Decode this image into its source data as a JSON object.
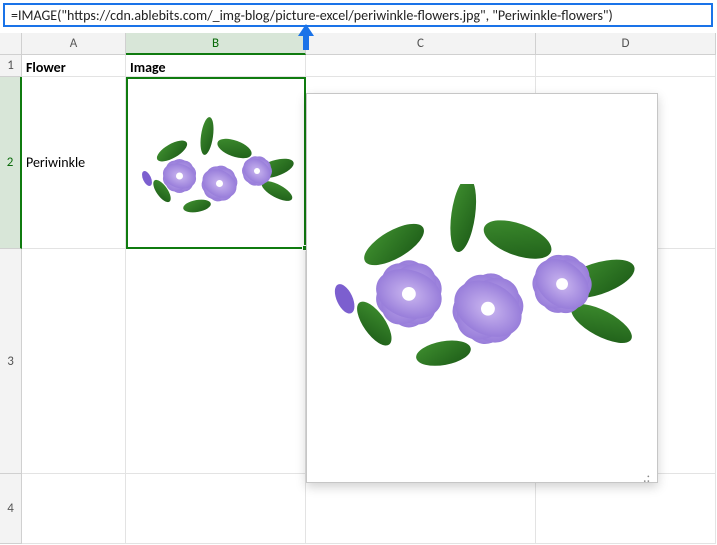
{
  "formula_bar": {
    "text": "=IMAGE(\"https://cdn.ablebits.com/_img-blog/picture-excel/periwinkle-flowers.jpg\", \"Periwinkle-flowers\")"
  },
  "columns": {
    "A": "A",
    "B": "B",
    "C": "C",
    "D": "D"
  },
  "rows": {
    "r1": "1",
    "r2": "2",
    "r3": "3",
    "r4": "4"
  },
  "cells": {
    "A1": "Flower",
    "B1": "Image",
    "A2": "Periwinkle"
  },
  "icons": {
    "resize_grip": ".:"
  }
}
